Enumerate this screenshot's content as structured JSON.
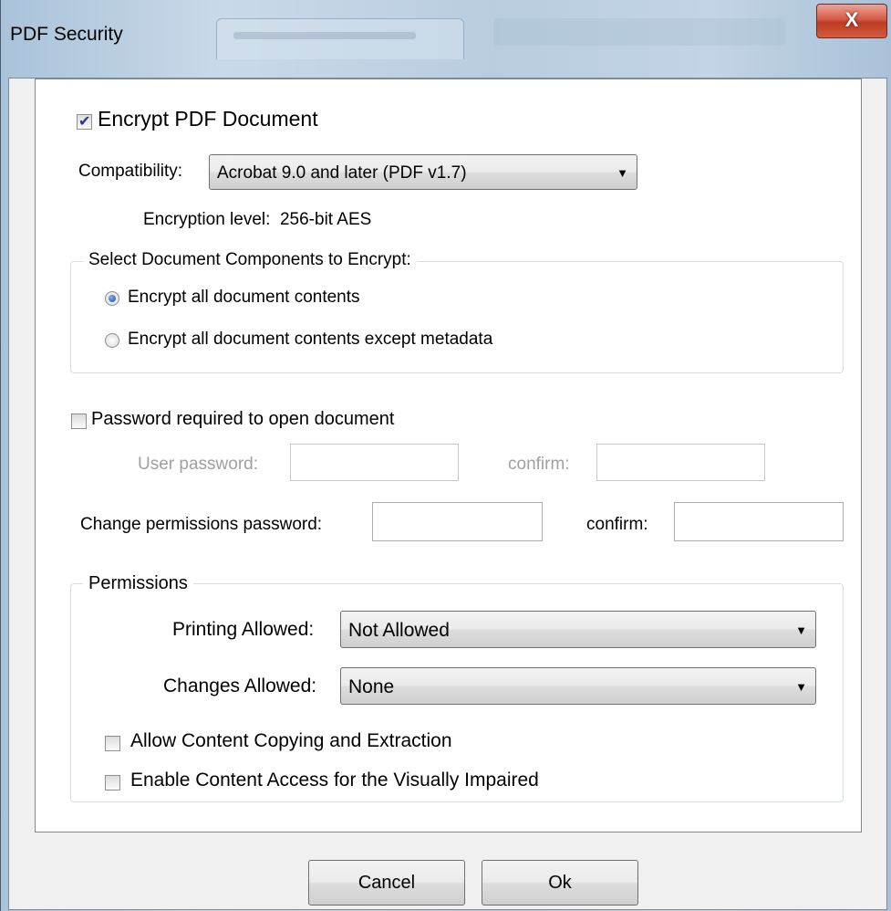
{
  "window": {
    "title": "PDF Security",
    "close_glyph": "X"
  },
  "encrypt": {
    "label": "Encrypt PDF Document",
    "checked": true
  },
  "compatibility": {
    "label": "Compatibility:",
    "value": "Acrobat 9.0 and later (PDF v1.7)"
  },
  "encryption_level": {
    "label": "Encryption level:",
    "value": "256-bit AES"
  },
  "components": {
    "legend": "Select Document Components to Encrypt:",
    "options": [
      {
        "label": "Encrypt all document contents",
        "selected": true
      },
      {
        "label": "Encrypt all document contents except metadata",
        "selected": false
      }
    ]
  },
  "open_password": {
    "label": "Password required to open document",
    "checked": false,
    "user_label": "User password:",
    "user_value": "",
    "confirm_label": "confirm:",
    "confirm_value": ""
  },
  "permissions_password": {
    "label": "Change permissions password:",
    "value": "",
    "confirm_label": "confirm:",
    "confirm_value": ""
  },
  "permissions": {
    "legend": "Permissions",
    "printing_label": "Printing Allowed:",
    "printing_value": "Not Allowed",
    "changes_label": "Changes Allowed:",
    "changes_value": "None",
    "copy_label": "Allow Content Copying and Extraction",
    "copy_checked": false,
    "access_label": "Enable Content Access for the Visually Impaired",
    "access_checked": false
  },
  "buttons": {
    "cancel": "Cancel",
    "ok": "Ok"
  },
  "colors": {
    "close_button": "#c8432b",
    "radio_selected": "#1f4f9a",
    "check_mark": "#26348b"
  }
}
